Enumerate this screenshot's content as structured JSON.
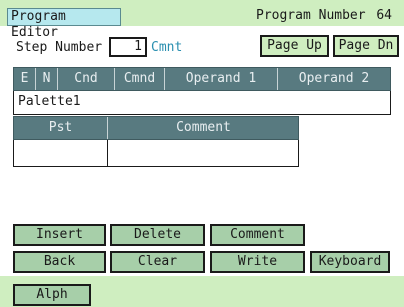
{
  "title": "Program Editor",
  "program_number_label": "Program Number",
  "program_number": "64",
  "step_label": "Step Number",
  "step_value": "1",
  "cmnt_label": "Cmnt",
  "page_up": "Page Up",
  "page_dn": "Page Dn",
  "columns": [
    "E",
    "N",
    "Cnd",
    "Cmnd",
    "Operand 1",
    "Operand 2"
  ],
  "palette_row": "Palette1",
  "sub_columns": [
    "Pst",
    "Comment"
  ],
  "buttons": {
    "insert": "Insert",
    "delete": "Delete",
    "comment": "Comment",
    "back": "Back",
    "clear": "Clear",
    "write": "Write",
    "keyboard": "Keyboard",
    "alph": "Alph"
  },
  "colors": {
    "title_bar": "#cfeec0",
    "title_label": "#b6e8ee",
    "table_header": "#587a80",
    "button": "#a7cfa9",
    "cmnt_text": "#2a8fb0"
  }
}
